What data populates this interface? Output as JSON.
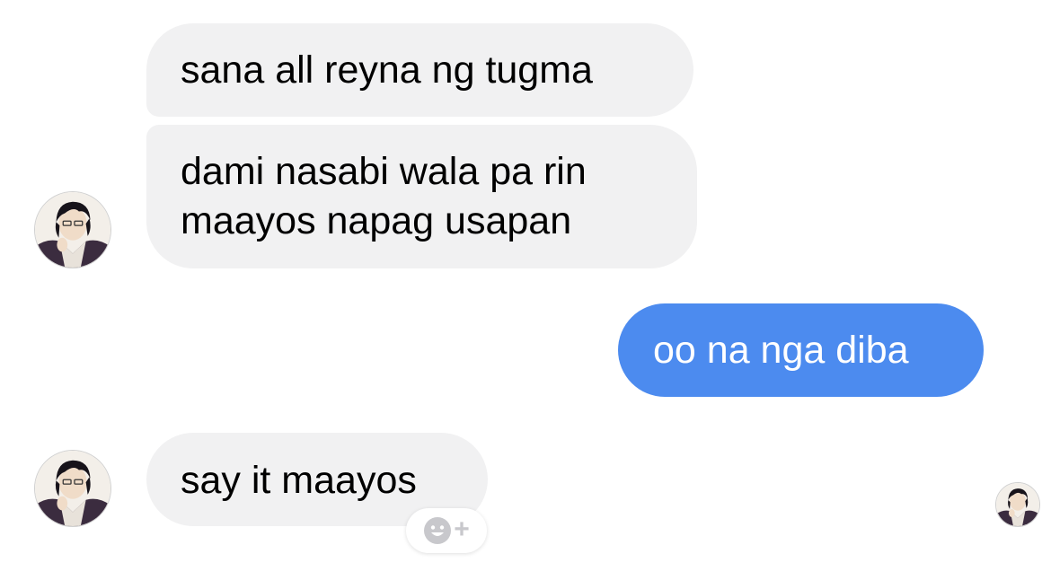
{
  "messages": [
    {
      "direction": "incoming",
      "text": "sana all reyna ng tugma"
    },
    {
      "direction": "incoming",
      "lines": [
        "dami nasabi wala pa rin",
        "maayos napag usapan"
      ]
    },
    {
      "direction": "outgoing",
      "text": "oo na nga diba"
    },
    {
      "direction": "incoming",
      "text": "say it maayos"
    }
  ],
  "react_button": {
    "icon": "smiley-add-icon",
    "plus": "+"
  },
  "avatar_icon": "profile-avatar",
  "colors": {
    "incoming_bubble": "#f1f1f2",
    "outgoing_bubble": "#4c8bef",
    "outgoing_text": "#ffffff",
    "incoming_text": "#000000"
  }
}
